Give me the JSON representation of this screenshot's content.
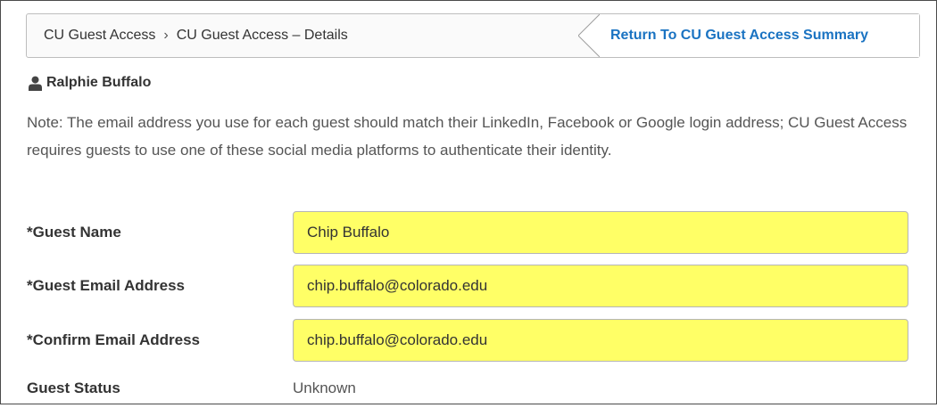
{
  "breadcrumb": {
    "items": [
      "CU Guest Access",
      "CU Guest Access – Details"
    ],
    "separator": "›",
    "return_link": "Return To CU Guest Access Summary"
  },
  "user": {
    "icon": "user-icon",
    "name": "Ralphie Buffalo"
  },
  "note": "Note: The email address you use for each guest should match their LinkedIn, Facebook or Google login address; CU Guest Access requires guests to use one of these social media platforms to authenticate their identity.",
  "form": {
    "guest_name": {
      "label": "*Guest Name",
      "value": "Chip Buffalo"
    },
    "guest_email": {
      "label": "*Guest Email Address",
      "value": "chip.buffalo@colorado.edu"
    },
    "confirm_email": {
      "label": "*Confirm Email Address",
      "value": "chip.buffalo@colorado.edu"
    },
    "guest_status": {
      "label": "Guest Status",
      "value": "Unknown"
    }
  },
  "colors": {
    "link": "#1a73c2",
    "field_highlight": "#ffff66"
  }
}
